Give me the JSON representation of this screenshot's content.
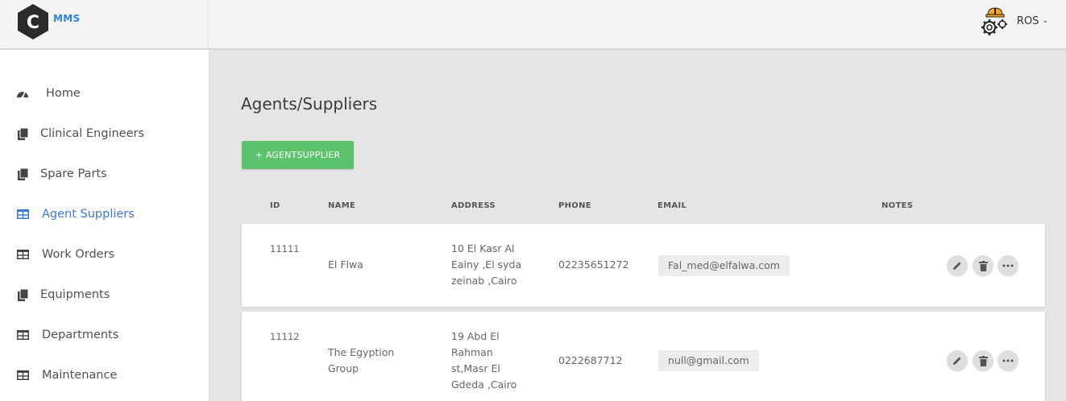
{
  "app": {
    "logo_letter": "C",
    "logo_text": "MMS",
    "user_name": "ROS"
  },
  "sidebar": {
    "items": [
      {
        "label": "Home",
        "icon": "dashboard-icon"
      },
      {
        "label": "Clinical Engineers",
        "icon": "copy-icon"
      },
      {
        "label": "Spare Parts",
        "icon": "copy-icon"
      },
      {
        "label": "Agent Suppliers",
        "icon": "table-icon",
        "active": true
      },
      {
        "label": "Work Orders",
        "icon": "table-icon"
      },
      {
        "label": "Equipments",
        "icon": "copy-icon"
      },
      {
        "label": "Departments",
        "icon": "table-icon"
      },
      {
        "label": "Maintenance",
        "icon": "table-icon"
      }
    ]
  },
  "main": {
    "title": "Agents/Suppliers",
    "add_button": "+ AGENTSUPPLIER",
    "table": {
      "headers": [
        "ID",
        "NAME",
        "ADDRESS",
        "PHONE",
        "EMAIL",
        "NOTES"
      ],
      "rows": [
        {
          "id": "11111",
          "name": "El Flwa",
          "address_lines": [
            "10 El Kasr Al",
            "Eainy ,El syda",
            "zeinab ,Cairo"
          ],
          "phone": "02235651272",
          "email": "Fal_med@elfalwa.com",
          "notes": ""
        },
        {
          "id": "11112",
          "name_lines": [
            "The Egyption",
            "Group"
          ],
          "address_lines": [
            "19 Abd El",
            "Rahman",
            "st,Masr El",
            "Gdeda ,Cairo"
          ],
          "phone": "0222687712",
          "email": "null@gmail.com",
          "notes": ""
        }
      ]
    }
  },
  "colors": {
    "accent": "#3a7bd5",
    "brand": "#2f80ed",
    "add_button": "#5cc26b",
    "content_bg": "#e5e5e5"
  }
}
